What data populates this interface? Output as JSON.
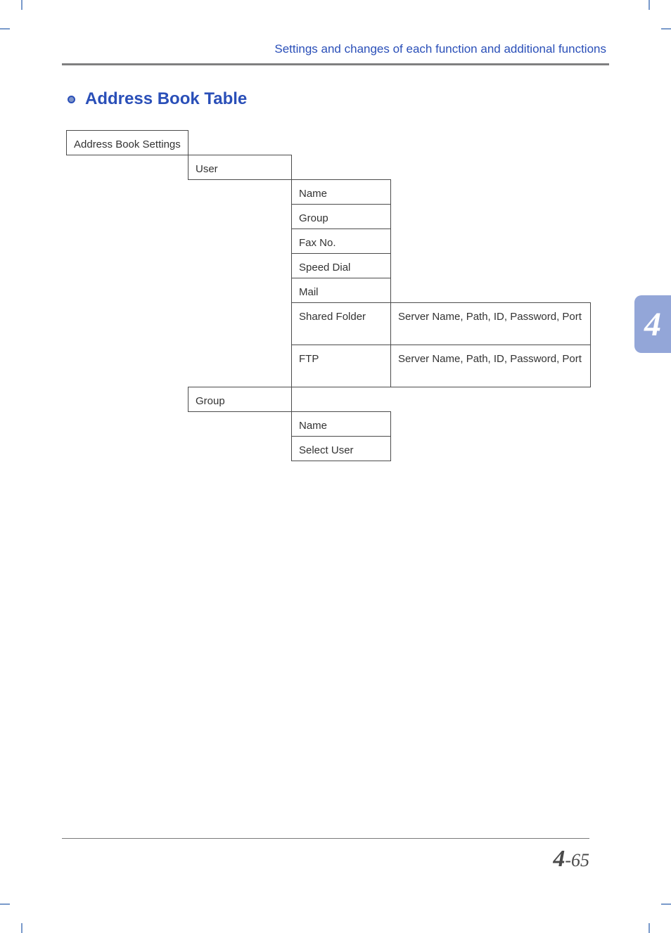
{
  "header": {
    "running": "Settings and changes of each function and additional functions"
  },
  "section": {
    "title": "Address Book Table"
  },
  "table": {
    "root": "Address Book Settings",
    "user": "User",
    "user_items": {
      "name": "Name",
      "group": "Group",
      "fax_no": "Fax No.",
      "speed_dial": "Speed Dial",
      "mail": "Mail",
      "shared_folder": "Shared Folder",
      "shared_folder_detail": "Server Name, Path, ID, Password, Port",
      "ftp": "FTP",
      "ftp_detail": "Server Name, Path, ID, Password, Port"
    },
    "group": "Group",
    "group_items": {
      "name": "Name",
      "select_user": "Select User"
    }
  },
  "side_tab": "4",
  "footer": {
    "chapter": "4",
    "separator": "-",
    "page": "65"
  }
}
